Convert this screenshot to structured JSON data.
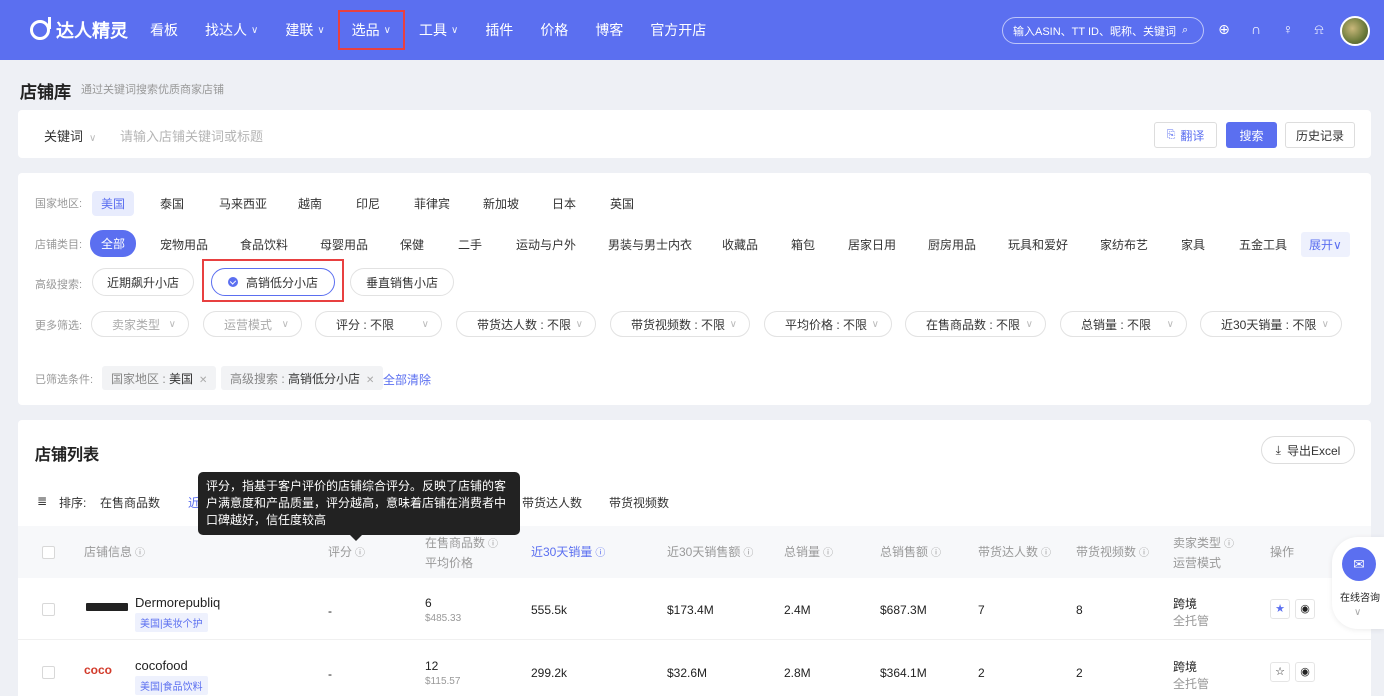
{
  "nav": {
    "logo": "达人精灵",
    "items": [
      {
        "label": "看板",
        "chev": ""
      },
      {
        "label": "找达人",
        "chev": "∨"
      },
      {
        "label": "建联",
        "chev": "∨"
      },
      {
        "label": "选品",
        "chev": "∨"
      },
      {
        "label": "工具",
        "chev": "∨"
      },
      {
        "label": "插件",
        "chev": ""
      },
      {
        "label": "价格",
        "chev": ""
      },
      {
        "label": "博客",
        "chev": ""
      },
      {
        "label": "官方开店",
        "chev": ""
      }
    ],
    "search_placeholder": "输入ASIN、TT ID、昵称、关键词",
    "icons": [
      "globe-icon",
      "headset-icon",
      "bulb-icon",
      "bell-icon"
    ]
  },
  "page": {
    "title": "店铺库",
    "subtitle": "通过关键词搜索优质商家店铺"
  },
  "keyword": {
    "select": "关键词",
    "placeholder": "请输入店铺关键词或标题",
    "translate": "翻译",
    "search": "搜索",
    "history": "历史记录"
  },
  "filters": {
    "country_label": "国家地区:",
    "countries": [
      "美国",
      "泰国",
      "马来西亚",
      "越南",
      "印尼",
      "菲律宾",
      "新加坡",
      "日本",
      "英国"
    ],
    "category_label": "店铺类目:",
    "categories": [
      "全部",
      "宠物用品",
      "食品饮料",
      "母婴用品",
      "保健",
      "二手",
      "运动与户外",
      "男装与男士内衣",
      "收藏品",
      "箱包",
      "居家日用",
      "厨房用品",
      "玩具和爱好",
      "家纺布艺",
      "家具",
      "五金工具"
    ],
    "expand": "展开∨",
    "advanced_label": "高级搜索:",
    "advanced": [
      "近期飙升小店",
      "高销低分小店",
      "垂直销售小店"
    ],
    "more_label": "更多筛选:",
    "dropdowns": [
      "卖家类型",
      "运营模式",
      "评分 : 不限",
      "带货达人数 : 不限",
      "带货视频数 : 不限",
      "平均价格 : 不限",
      "在售商品数 : 不限",
      "总销量 : 不限",
      "近30天销量 : 不限"
    ],
    "selected_label": "已筛选条件:",
    "selected_tags": [
      {
        "k": "国家地区 : ",
        "v": "美国"
      },
      {
        "k": "高级搜索 : ",
        "v": "高销低分小店"
      }
    ],
    "clear_all": "全部清除"
  },
  "list": {
    "title": "店铺列表",
    "export": "导出Excel",
    "sort_label": "排序:",
    "sort_options": [
      "在售商品数",
      "近",
      "带货达人数",
      "带货视频数"
    ],
    "headers": {
      "shop": "店铺信息",
      "score": "评分",
      "goods_1": "在售商品数",
      "goods_2": "平均价格",
      "sales30": "近30天销量",
      "revenue30": "近30天销售额",
      "total_sales": "总销量",
      "total_revenue": "总销售额",
      "creators": "带货达人数",
      "videos": "带货视频数",
      "seller_1": "卖家类型",
      "seller_2": "运营模式",
      "ops": "操作"
    },
    "rows": [
      {
        "logo": "DERMOREPUBLIQ",
        "name": "Dermorepubliq",
        "tag": "美国|美妆个护",
        "score": "-",
        "goods": "6",
        "avg_price": "$485.33",
        "sales30": "555.5k",
        "revenue30": "$173.4M",
        "total_sales": "2.4M",
        "total_revenue": "$687.3M",
        "creators": "7",
        "videos": "8",
        "seller_type": "跨境",
        "op_mode": "全托管",
        "starred": true
      },
      {
        "logo": "coco",
        "name": "cocofood",
        "tag": "美国|食品饮料",
        "score": "-",
        "goods": "12",
        "avg_price": "$115.57",
        "sales30": "299.2k",
        "revenue30": "$32.6M",
        "total_sales": "2.8M",
        "total_revenue": "$364.1M",
        "creators": "2",
        "videos": "2",
        "seller_type": "跨境",
        "op_mode": "全托管",
        "starred": false
      }
    ]
  },
  "tooltip": {
    "text": "评分，指基于客户评价的店铺综合评分。反映了店铺的客户满意度和产品质量，评分越高，意味着店铺在消费者中口碑越好，信任度较高"
  },
  "consult": {
    "label": "在线咨询"
  },
  "colors": {
    "brand": "#5b6ff0",
    "highlight_box": "#e84040"
  }
}
